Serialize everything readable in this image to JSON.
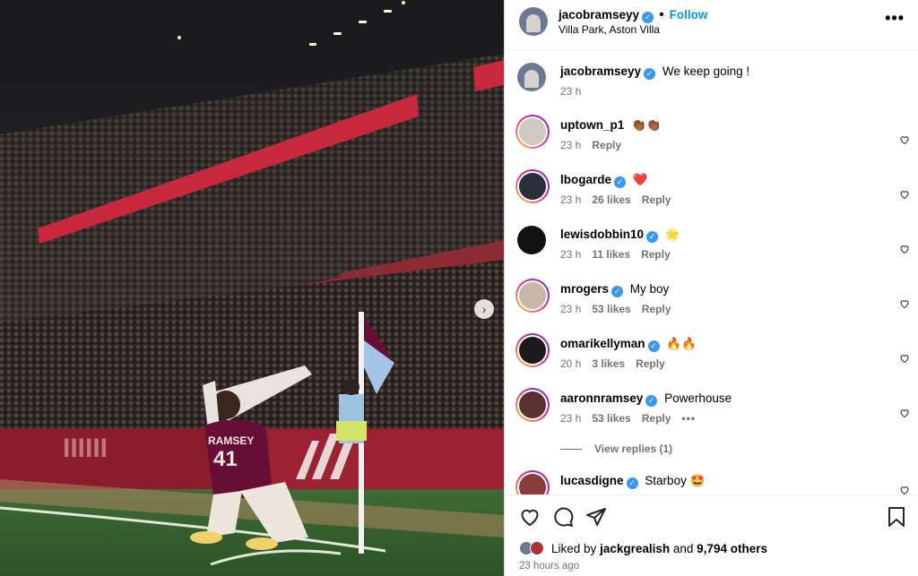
{
  "post": {
    "username": "jacobramseyy",
    "follow_label": "Follow",
    "location": "Villa Park, Aston Villa",
    "separator": "•",
    "more_label": "•••"
  },
  "photo": {
    "next_label": "›",
    "shirt_name": "RAMSEY",
    "shirt_number": "41"
  },
  "caption": {
    "username": "jacobramseyy",
    "text": "We keep going !",
    "time": "23 h"
  },
  "comments": [
    {
      "username": "uptown_p1",
      "verified": false,
      "text": "👏🏾👏🏾",
      "time": "23 h",
      "likes": "",
      "reply": "Reply"
    },
    {
      "username": "lbogarde",
      "verified": true,
      "text": "❤️",
      "time": "23 h",
      "likes": "26 likes",
      "reply": "Reply"
    },
    {
      "username": "lewisdobbin10",
      "verified": true,
      "text": "🌟",
      "time": "23 h",
      "likes": "11 likes",
      "reply": "Reply"
    },
    {
      "username": "mrogers",
      "verified": true,
      "text": "My boy",
      "time": "23 h",
      "likes": "53 likes",
      "reply": "Reply"
    },
    {
      "username": "omarikellyman",
      "verified": true,
      "text": "🔥🔥",
      "time": "20 h",
      "likes": "3 likes",
      "reply": "Reply"
    },
    {
      "username": "aaronnramsey",
      "verified": true,
      "text": "Powerhouse",
      "time": "23 h",
      "likes": "53 likes",
      "reply": "Reply",
      "more": "•••"
    },
    {
      "username": "lucasdigne",
      "verified": true,
      "text": "Starboy 🤩",
      "time": "",
      "likes": "",
      "reply": ""
    }
  ],
  "view_replies": "View replies (1)",
  "footer": {
    "liked_prefix": "Liked by",
    "liked_user": "jackgrealish",
    "liked_and": "and",
    "liked_count": "9,794 others",
    "time_ago": "23 hours ago"
  },
  "colors": {
    "accent": "#0095f6",
    "verified": "#3897f0",
    "muted": "#737373",
    "claret": "#670e36"
  }
}
